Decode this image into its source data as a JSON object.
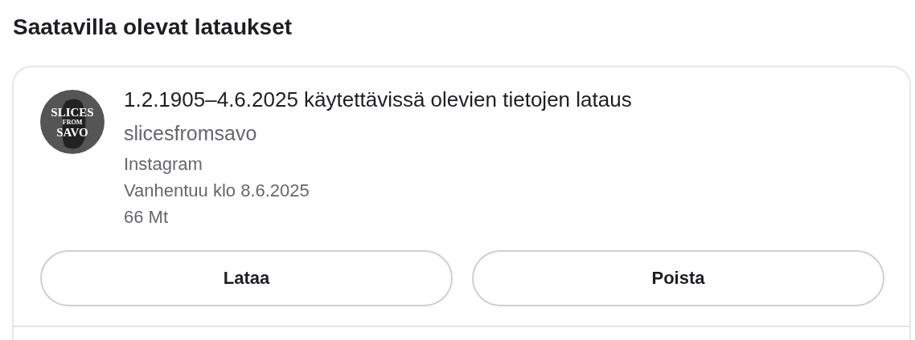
{
  "heading": "Saatavilla olevat lataukset",
  "downloads": [
    {
      "avatar": {
        "lines": [
          "SLICES",
          "FROM",
          "SAVO"
        ]
      },
      "title": "1.2.1905–4.6.2025 käytettävissä olevien tietojen lataus",
      "account": "slicesfromsavo",
      "details": [
        "Instagram",
        "Vanhentuu klo 8.6.2025",
        "66 Mt"
      ],
      "buttons": [
        "Lataa",
        "Poista"
      ]
    }
  ]
}
